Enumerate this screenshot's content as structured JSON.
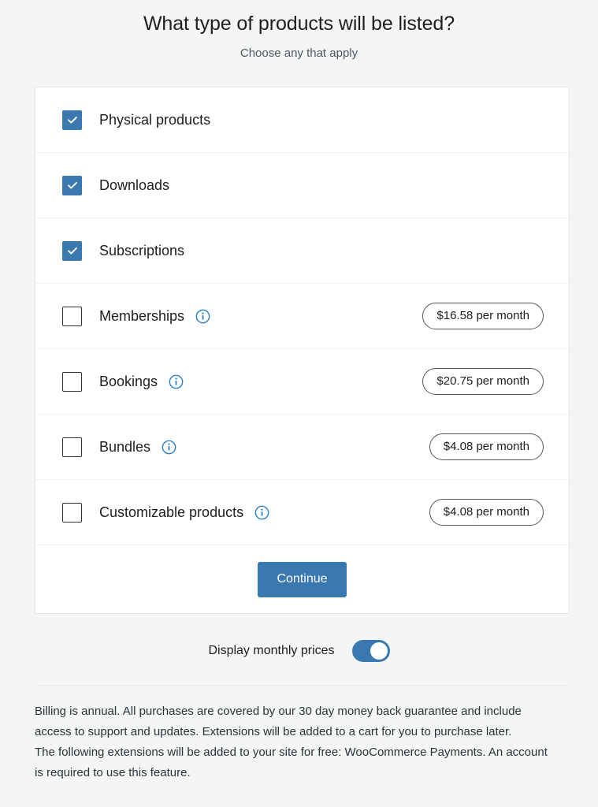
{
  "header": {
    "title": "What type of products will be listed?",
    "subtitle": "Choose any that apply"
  },
  "colors": {
    "accent": "#3a79b0",
    "page_background": "#f4f6f5",
    "card_background": "#ffffff",
    "text": "#1e1e1e",
    "muted_text": "#50575e",
    "border": "#e2e4e7",
    "info_icon": "#2f80c4"
  },
  "product_rows": [
    {
      "label": "Physical products",
      "checked": true,
      "has_info_icon": false,
      "info_icon_name": "info-icon",
      "price": null
    },
    {
      "label": "Downloads",
      "checked": true,
      "has_info_icon": false,
      "info_icon_name": "info-icon",
      "price": null
    },
    {
      "label": "Subscriptions",
      "checked": true,
      "has_info_icon": false,
      "info_icon_name": "info-icon",
      "price": null
    },
    {
      "label": "Memberships",
      "checked": false,
      "has_info_icon": true,
      "info_icon_name": "info-icon",
      "price": "$16.58 per month"
    },
    {
      "label": "Bookings",
      "checked": false,
      "has_info_icon": true,
      "info_icon_name": "info-icon",
      "price": "$20.75 per month"
    },
    {
      "label": "Bundles",
      "checked": false,
      "has_info_icon": true,
      "info_icon_name": "info-icon",
      "price": "$4.08 per month"
    },
    {
      "label": "Customizable products",
      "checked": false,
      "has_info_icon": true,
      "info_icon_name": "info-icon",
      "price": "$4.08 per month"
    }
  ],
  "actions": {
    "continue_label": "Continue"
  },
  "toggle": {
    "label": "Display monthly prices",
    "on": true
  },
  "footer": {
    "paragraph_1": "Billing is annual. All purchases are covered by our 30 day money back guarantee and include access to support and updates. Extensions will be added to a cart for you to purchase later.",
    "paragraph_2": "The following extensions will be added to your site for free: WooCommerce Payments. An account is required to use this feature."
  }
}
